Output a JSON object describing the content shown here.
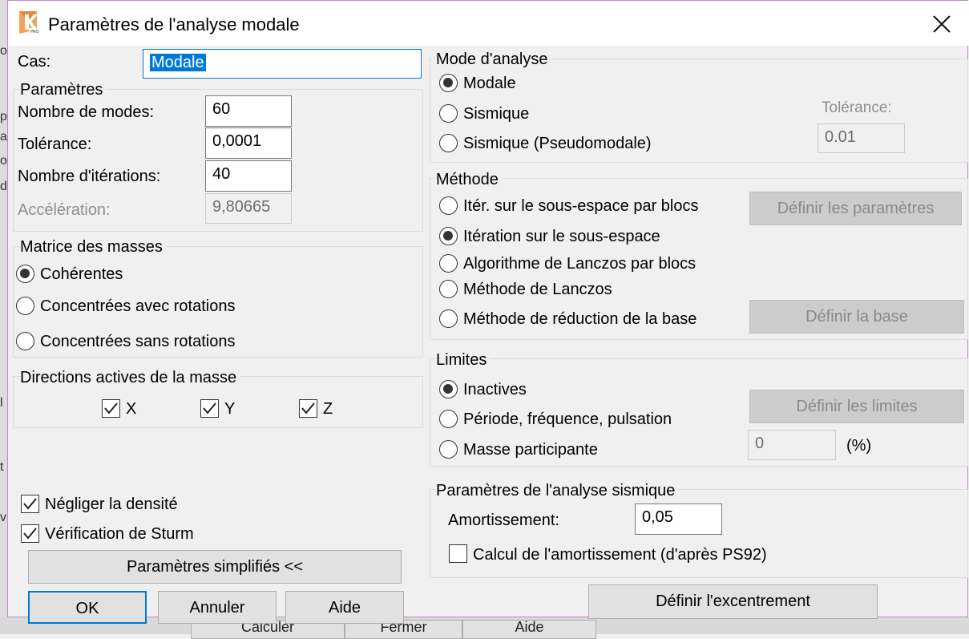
{
  "dialog": {
    "title": "Paramètres de l'analyse modale",
    "app_icon": "robot-structural-analysis-pro-icon",
    "close_icon": "close-icon"
  },
  "cas": {
    "label": "Cas:",
    "value": "Modale"
  },
  "parametres": {
    "title": "Paramètres",
    "nb_modes_label": "Nombre de modes:",
    "nb_modes_value": "60",
    "tolerance_label": "Tolérance:",
    "tolerance_value": "0,0001",
    "nb_iter_label": "Nombre d'itérations:",
    "nb_iter_value": "40",
    "acceleration_label": "Accélération:",
    "acceleration_value": "9,80665"
  },
  "matrice": {
    "title": "Matrice des masses",
    "opt1": "Cohérentes",
    "opt2": "Concentrées avec rotations",
    "opt3": "Concentrées sans rotations",
    "selected": "Cohérentes"
  },
  "directions": {
    "title": "Directions actives de la masse",
    "x": "X",
    "y": "Y",
    "z": "Z",
    "checked": [
      "X",
      "Y",
      "Z"
    ]
  },
  "negliger": {
    "label": "Négliger la densité",
    "checked": true
  },
  "sturm": {
    "label": "Vérification de Sturm",
    "checked": true
  },
  "buttons": {
    "simplified": "Paramètres simplifiés <<",
    "ok": "OK",
    "cancel": "Annuler",
    "help": "Aide",
    "excentrement": "Définir l'excentrement"
  },
  "mode": {
    "title": "Mode d'analyse",
    "opt1": "Modale",
    "opt2": "Sismique",
    "opt3": "Sismique (Pseudomodale)",
    "selected": "Modale",
    "tolerance_label": "Tolérance:",
    "tolerance_value": "0.01"
  },
  "methode": {
    "title": "Méthode",
    "opt1": "Itér. sur le sous-espace par blocs",
    "opt2": "Itération sur le sous-espace",
    "opt3": "Algorithme de Lanczos par blocs",
    "opt4": "Méthode de Lanczos",
    "opt5": "Méthode de réduction de la base",
    "selected": "Itération sur le sous-espace",
    "define_params": "Définir les paramètres",
    "define_base": "Définir la base"
  },
  "limites": {
    "title": "Limites",
    "opt1": "Inactives",
    "opt2": "Période, fréquence, pulsation",
    "opt3": "Masse participante",
    "selected": "Inactives",
    "define_limits": "Définir les limites",
    "mass_value": "0",
    "mass_unit": "(%)"
  },
  "sismique": {
    "title": "Paramètres de l'analyse sismique",
    "amort_label": "Amortissement:",
    "amort_value": "0,05",
    "calc_label": "Calcul de l'amortissement (d'après PS92)",
    "calc_checked": false
  },
  "background": {
    "left_chars": [
      "o",
      "p",
      "a",
      "o",
      "d",
      "l",
      "t",
      "v"
    ],
    "bottom_buttons": [
      "Calculer",
      "Fermer",
      "Aide"
    ]
  },
  "colors": {
    "accent": "#0078d7",
    "dialog_border": "#c488c9",
    "app_bg": "#f0f0f0"
  }
}
